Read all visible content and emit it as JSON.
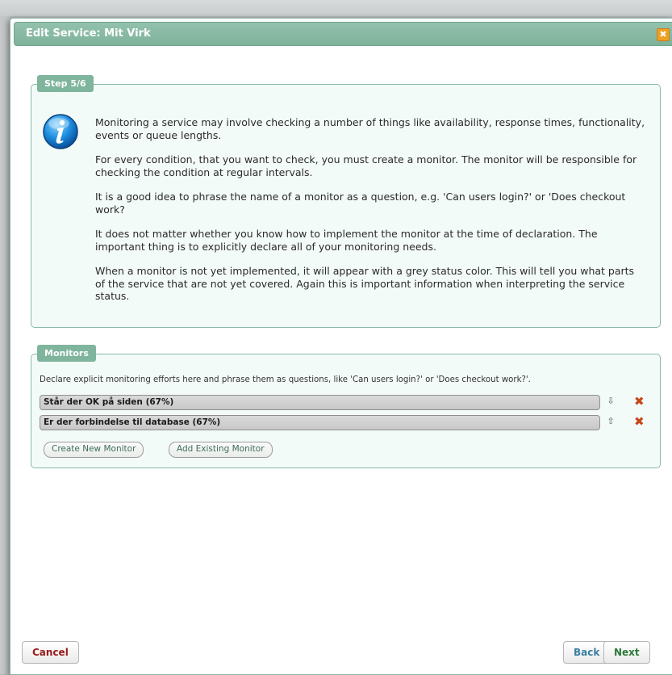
{
  "dialog": {
    "title": "Edit Service: Mit Virk",
    "close_glyph": "✖"
  },
  "step": {
    "legend": "Step 5/6",
    "icon": "info-icon",
    "paragraphs": [
      "Monitoring a service may involve checking a number of things like availability, response times, functionality, events or queue lengths.",
      "For every condition, that you want to check, you must create a monitor. The monitor will be responsible for checking the condition at regular intervals.",
      "It is a good idea to phrase the name of a monitor as a question, e.g. 'Can users login?' or 'Does checkout work?",
      "It does not matter whether you know how to implement the monitor at the time of declaration. The important thing is to explicitly declare all of your monitoring needs.",
      "When a monitor is not yet implemented, it will appear with a grey status color. This will tell you what parts of the service that are not yet covered. Again this is important information when interpreting the service status."
    ]
  },
  "monitors": {
    "legend": "Monitors",
    "description": "Declare explicit monitoring efforts here and phrase them as questions, like 'Can users login?' or 'Does checkout work?'.",
    "items": [
      {
        "label": "Står der OK på siden (67%)",
        "arrow": "⇩",
        "delete": "✖"
      },
      {
        "label": "Er der forbindelse til database (67%)",
        "arrow": "⇧",
        "delete": "✖"
      }
    ],
    "create_label": "Create New Monitor",
    "add_existing_label": "Add Existing Monitor"
  },
  "footer": {
    "cancel_label": "Cancel",
    "back_label": "Back",
    "next_label": "Next"
  },
  "colors": {
    "accent": "#7fb49d",
    "panel_bg": "#f3fbf8",
    "close": "#f0a020",
    "delete": "#c8461b",
    "cancel": "#9b1a1a",
    "back": "#3a7fa3",
    "next": "#2d7a3a"
  }
}
